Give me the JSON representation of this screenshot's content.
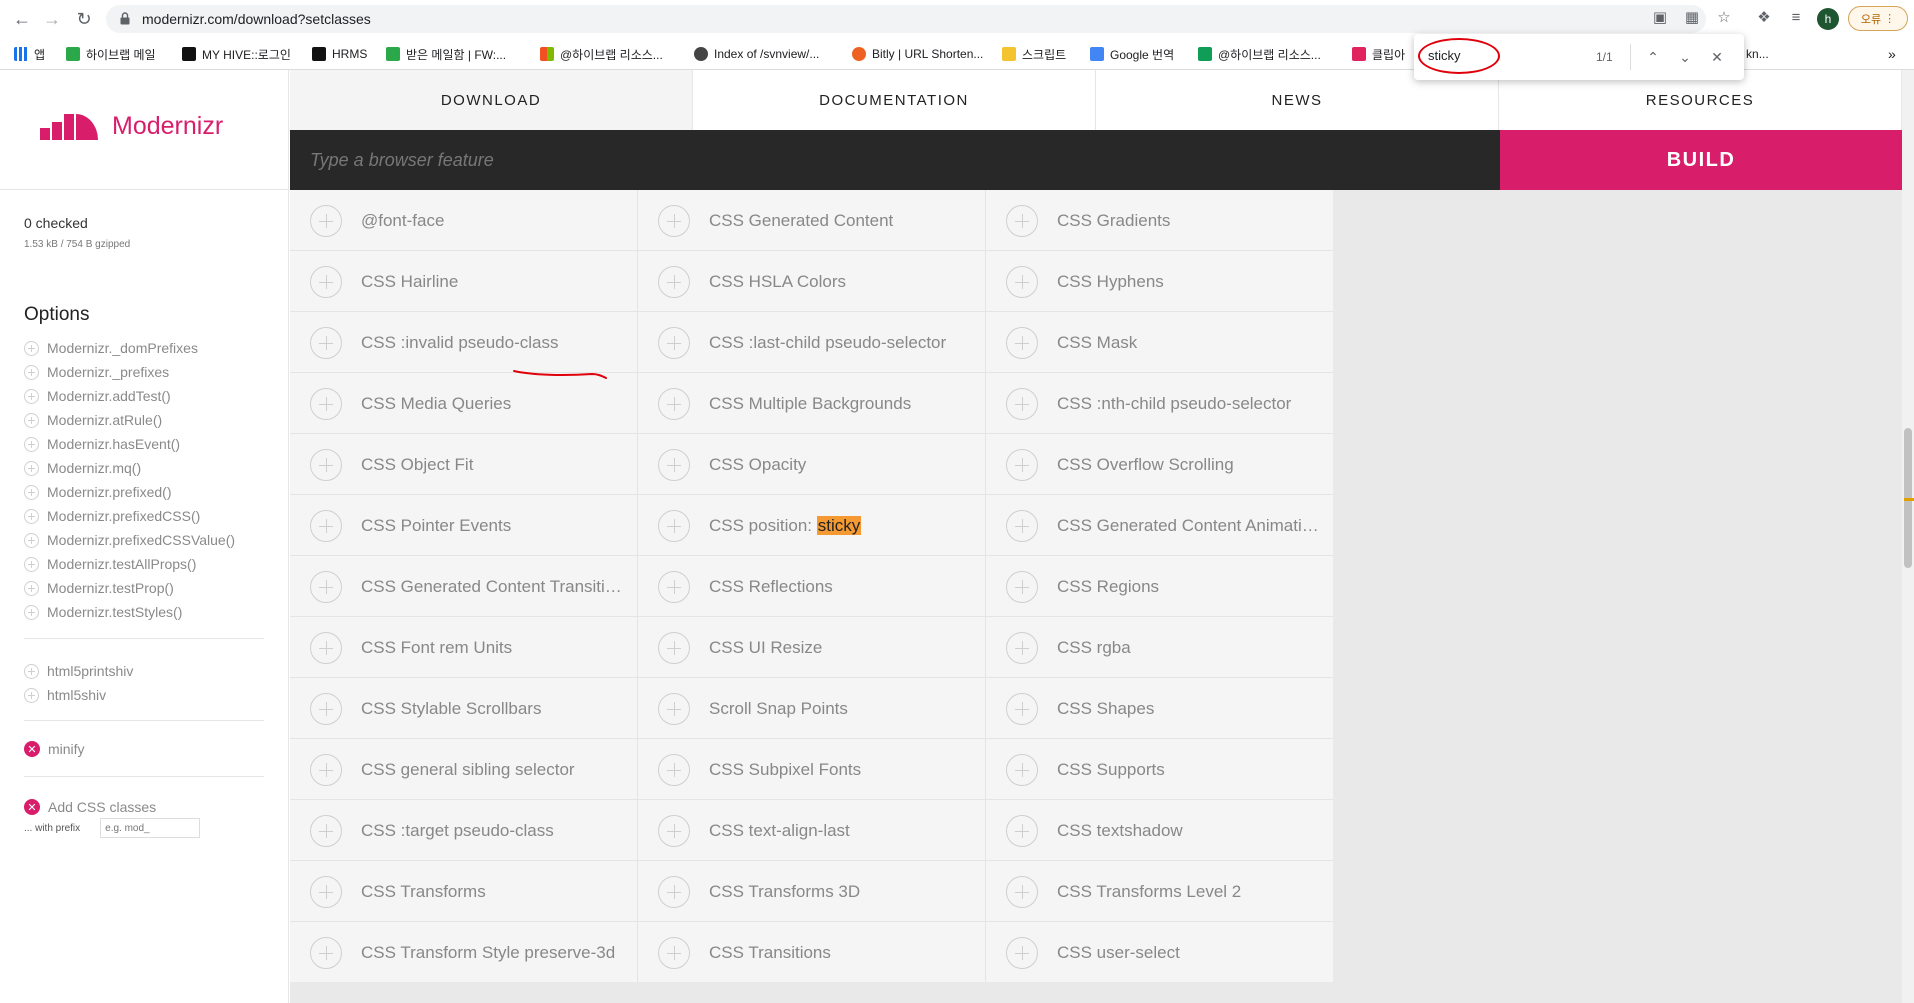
{
  "browser": {
    "url": "modernizr.com/download?setclasses",
    "profile_initial": "h",
    "error_label": "오류",
    "bookmarks": [
      {
        "label": "앱",
        "color": "#1a73e8"
      },
      {
        "label": "하이브랩 메일",
        "color": "#2ba84a"
      },
      {
        "label": "MY HIVE::로그인",
        "color": "#111111"
      },
      {
        "label": "HRMS",
        "color": "#111111"
      },
      {
        "label": "받은 메일함 | FW:...",
        "color": "#2ba84a"
      },
      {
        "label": "@하이브랩 리소스...",
        "color": "#f25022"
      },
      {
        "label": "Index of /svnview/...",
        "color": "#444444"
      },
      {
        "label": "Bitly | URL Shorten...",
        "color": "#ee6123"
      },
      {
        "label": "스크립트",
        "color": "#f4c430"
      },
      {
        "label": "Google 번역",
        "color": "#4285f4"
      },
      {
        "label": "@하이브랩 리소스...",
        "color": "#0f9d58"
      },
      {
        "label": "클립아",
        "color": "#e0245e"
      },
      {
        "label": "ed to kn...",
        "color": "#ffffff"
      }
    ],
    "find": {
      "query": "sticky",
      "count": "1/1"
    }
  },
  "sidebar": {
    "logo_text": "Modernizr",
    "checked_label": "0 checked",
    "size_label": "1.53 kB / 754 B gzipped",
    "options_title": "Options",
    "options": [
      "Modernizr._domPrefixes",
      "Modernizr._prefixes",
      "Modernizr.addTest()",
      "Modernizr.atRule()",
      "Modernizr.hasEvent()",
      "Modernizr.mq()",
      "Modernizr.prefixed()",
      "Modernizr.prefixedCSS()",
      "Modernizr.prefixedCSSValue()",
      "Modernizr.testAllProps()",
      "Modernizr.testProp()",
      "Modernizr.testStyles()"
    ],
    "shivs": [
      "html5printshiv",
      "html5shiv"
    ],
    "minify_label": "minify",
    "add_css_label": "Add CSS classes",
    "prefix_label": "... with prefix",
    "prefix_placeholder": "e.g. mod_"
  },
  "nav": {
    "tabs": [
      "DOWNLOAD",
      "DOCUMENTATION",
      "NEWS",
      "RESOURCES"
    ],
    "active_tab": 0
  },
  "search": {
    "placeholder": "Type a browser feature"
  },
  "build_label": "BUILD",
  "features": [
    "@font-face",
    "CSS Generated Content",
    "CSS Gradients",
    "CSS Hairline",
    "CSS HSLA Colors",
    "CSS Hyphens",
    "CSS :invalid pseudo-class",
    "CSS :last-child pseudo-selector",
    "CSS Mask",
    "CSS Media Queries",
    "CSS Multiple Backgrounds",
    "CSS :nth-child pseudo-selector",
    "CSS Object Fit",
    "CSS Opacity",
    "CSS Overflow Scrolling",
    "CSS Pointer Events",
    "CSS position: sticky",
    "CSS Generated Content Animations",
    "CSS Generated Content Transitions",
    "CSS Reflections",
    "CSS Regions",
    "CSS Font rem Units",
    "CSS UI Resize",
    "CSS rgba",
    "CSS Stylable Scrollbars",
    "Scroll Snap Points",
    "CSS Shapes",
    "CSS general sibling selector",
    "CSS Subpixel Fonts",
    "CSS Supports",
    "CSS :target pseudo-class",
    "CSS text-align-last",
    "CSS textshadow",
    "CSS Transforms",
    "CSS Transforms 3D",
    "CSS Transforms Level 2",
    "CSS Transform Style preserve-3d",
    "CSS Transitions",
    "CSS user-select"
  ],
  "colors": {
    "accent": "#d81e6b",
    "highlight": "#f59a33",
    "dark_bar": "#282828"
  }
}
